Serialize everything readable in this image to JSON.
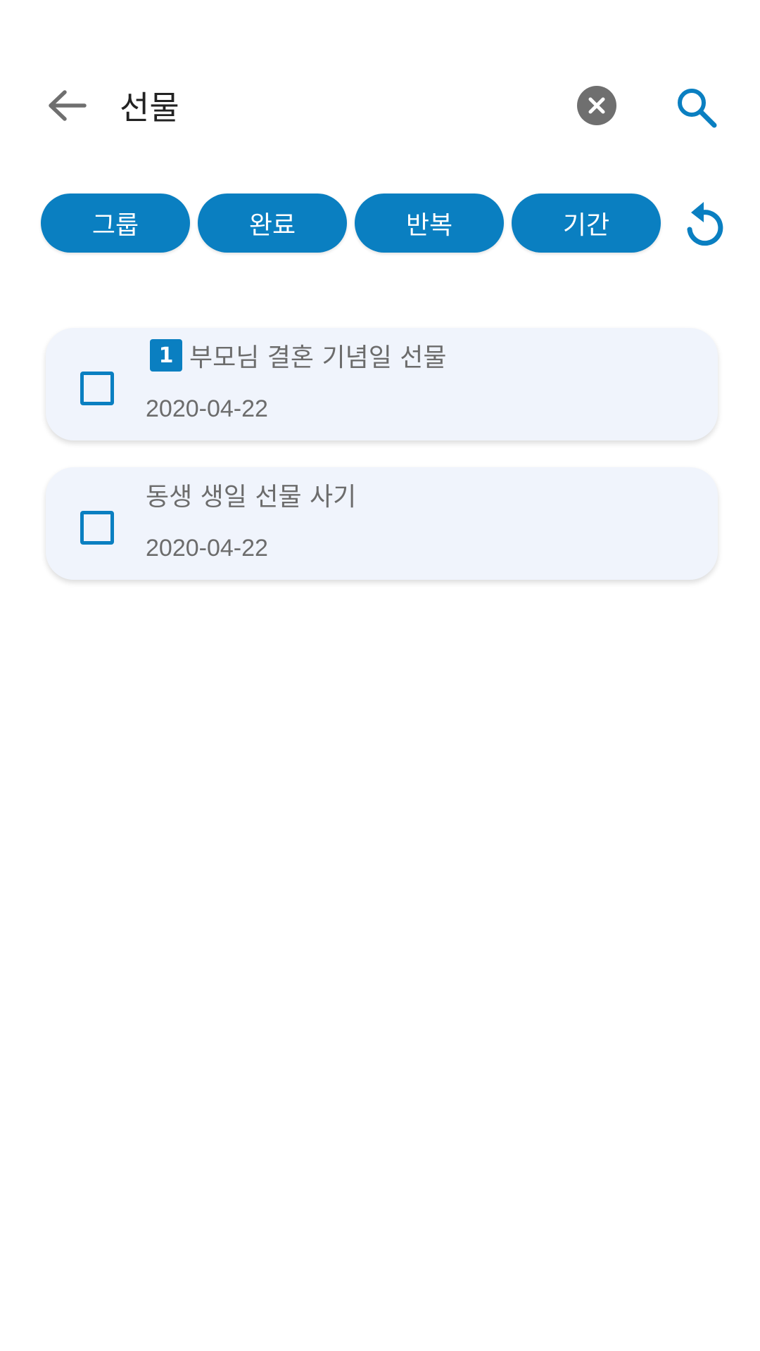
{
  "search": {
    "query": "선물"
  },
  "icons": {
    "back": "arrow-back-icon",
    "clear": "close-circle-icon",
    "search": "search-icon",
    "reset": "refresh-icon"
  },
  "colors": {
    "accent": "#0a7fc1",
    "card_background": "#f0f4fc",
    "text_secondary": "#6c6c6c",
    "clear_button": "#6f6f6f"
  },
  "filters": [
    {
      "label": "그룹"
    },
    {
      "label": "완료"
    },
    {
      "label": "반복"
    },
    {
      "label": "기간"
    }
  ],
  "results": [
    {
      "priority": "1",
      "title": "부모님 결혼 기념일 선물",
      "date": "2020-04-22",
      "checked": false
    },
    {
      "priority": "",
      "title": "동생 생일 선물 사기",
      "date": "2020-04-22",
      "checked": false
    }
  ]
}
